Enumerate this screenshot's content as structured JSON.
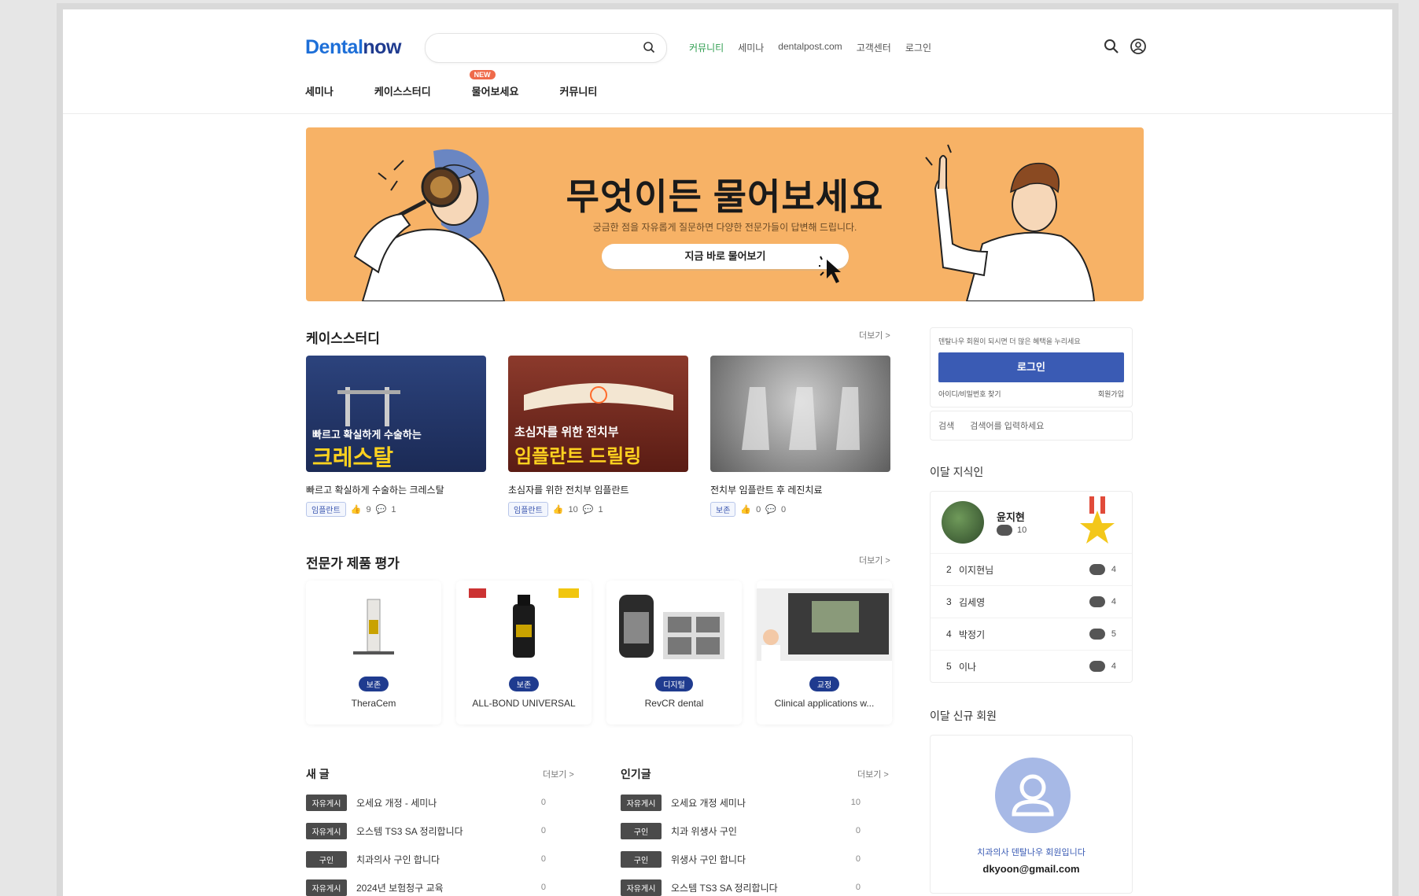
{
  "header": {
    "logo_prefix": "Dental",
    "logo_suffix": "now",
    "search_placeholder": "",
    "top_links": [
      "커뮤니티",
      "세미나",
      "dentalpost.com",
      "고객센터",
      "로그인"
    ],
    "nav": [
      {
        "label": "세미나"
      },
      {
        "label": "케이스스터디"
      },
      {
        "label": "물어보세요",
        "badge": "NEW"
      },
      {
        "label": "커뮤니티"
      }
    ]
  },
  "banner": {
    "title": "무엇이든 물어보세요",
    "subtitle": "궁금한 점을 자유롭게 질문하면 다양한 전문가들이 답변해 드립니다.",
    "cta": "지금 바로 물어보기"
  },
  "case_study": {
    "title": "케이스스터디",
    "more": "더보기 >",
    "items": [
      {
        "title": "빠르고 확실하게 수술하는 크레스탈",
        "tag": "임플란트",
        "likes": "9",
        "comments": "1",
        "overlay_top": "빠르고 확실하게 수술하는",
        "overlay_big": "크레스탈",
        "bg": "#2b3f7a"
      },
      {
        "title": "초심자를 위한 전치부 임플란트",
        "tag": "임플란트",
        "likes": "10",
        "comments": "1",
        "overlay_top": "초심자를 위한 전치부",
        "overlay_big": "임플란트 드릴링",
        "bg": "#7a2a20"
      },
      {
        "title": "전치부 임플란트 후 레진치료",
        "tag": "보존",
        "likes": "0",
        "comments": "0",
        "overlay_top": "",
        "overlay_big": "",
        "bg": "#8a8a8a"
      }
    ]
  },
  "products": {
    "title": "전문가 제품 평가",
    "more": "더보기 >",
    "items": [
      {
        "tag": "보존",
        "name": "TheraCem"
      },
      {
        "tag": "보존",
        "name": "ALL-BOND UNIVERSAL"
      },
      {
        "tag": "디지털",
        "name": "RevCR dental"
      },
      {
        "tag": "교정",
        "name": "Clinical applications w..."
      }
    ]
  },
  "new_posts": {
    "title": "새 글",
    "more": "더보기 >",
    "items": [
      {
        "cat": "자유게시",
        "title": "오세요 개정 - 세미나",
        "count": "0"
      },
      {
        "cat": "자유게시",
        "title": "오스템 TS3 SA 정리합니다",
        "count": "0"
      },
      {
        "cat": "구인",
        "title": "치과의사 구인 합니다",
        "count": "0"
      },
      {
        "cat": "자유게시",
        "title": "2024년 보험청구 교육",
        "count": "0"
      }
    ]
  },
  "popular_posts": {
    "title": "인기글",
    "more": "더보기 >",
    "items": [
      {
        "cat": "자유게시",
        "title": "오세요 개정 세미나",
        "count": "10"
      },
      {
        "cat": "구인",
        "title": "치과 위생사 구인",
        "count": "0"
      },
      {
        "cat": "구인",
        "title": "위생사 구인 합니다",
        "count": "0"
      },
      {
        "cat": "자유게시",
        "title": "오스템 TS3 SA 정리합니다",
        "count": "0"
      }
    ]
  },
  "sidebar": {
    "login_text": "덴탈나우 회원이 되시면 더 많은 혜택을 누리세요",
    "login_button": "로그인",
    "find_account": "아이디/비밀번호 찾기",
    "signup": "회원가입",
    "search_label": "검색",
    "search_hint": "검색어를 입력하세요",
    "ranking_title": "이달 지식인",
    "ranking_top": {
      "name": "윤지현",
      "count": "10"
    },
    "ranking": [
      {
        "rank": "2",
        "name": "이지현님",
        "count": "4"
      },
      {
        "rank": "3",
        "name": "김세영",
        "count": "4"
      },
      {
        "rank": "4",
        "name": "박정기",
        "count": "5"
      },
      {
        "rank": "5",
        "name": "이나",
        "count": "4"
      }
    ],
    "profile_title": "이달 신규 회원",
    "profile_line": "치과의사 덴탈나우 회원입니다",
    "profile_email": "dkyoon@gmail.com"
  },
  "colors": {
    "accent": "#1d6fd8",
    "navy": "#1f3b8f",
    "banner": "#f7b266",
    "login_btn": "#3a5bb4"
  }
}
